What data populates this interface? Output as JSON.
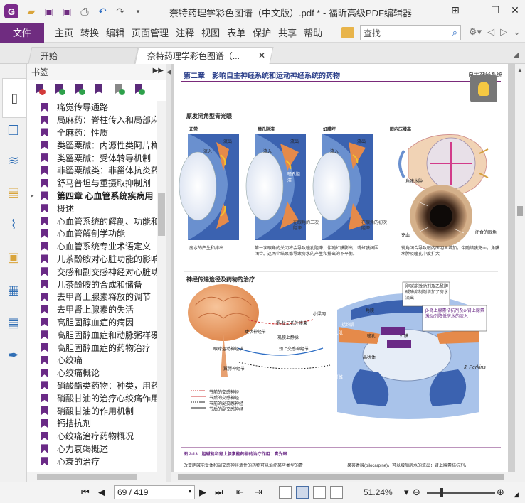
{
  "window": {
    "title": "奈特药理学彩色图谱（中文版）.pdf * - 福昕高级PDF编辑器",
    "app_logo": "G"
  },
  "ribbon": {
    "file_label": "文件",
    "tabs": [
      "主页",
      "转换",
      "编辑",
      "页面管理",
      "注释",
      "视图",
      "表单",
      "保护",
      "共享",
      "帮助"
    ],
    "search_placeholder": "查找"
  },
  "doc_tabs": {
    "start": "开始",
    "current": "奈特药理学彩色图谱（..."
  },
  "bookmarks": {
    "header": "书签",
    "items": [
      {
        "text": "痛觉传导通路",
        "bold": false,
        "expander": false
      },
      {
        "text": "局麻药：脊柱传入和局部麻",
        "bold": false,
        "expander": false
      },
      {
        "text": "全麻药：性质",
        "bold": false,
        "expander": false
      },
      {
        "text": "类罂粟碱：内源性类阿片样",
        "bold": false,
        "expander": false
      },
      {
        "text": "类罂粟碱：受体转导机制",
        "bold": false,
        "expander": false
      },
      {
        "text": "非罂粟碱类：非甾体抗炎药",
        "bold": false,
        "expander": false
      },
      {
        "text": "舒马普坦与重摄取抑制剂",
        "bold": false,
        "expander": false
      },
      {
        "text": "第四章 心血管系统疾病用",
        "bold": true,
        "expander": true
      },
      {
        "text": "概述",
        "bold": false,
        "expander": false
      },
      {
        "text": "心血管系统的解剖、功能和",
        "bold": false,
        "expander": false
      },
      {
        "text": "心血管解剖学功能",
        "bold": false,
        "expander": false
      },
      {
        "text": "心血管系统专业术语定义",
        "bold": false,
        "expander": false
      },
      {
        "text": "儿茶酚胺对心脏功能的影响",
        "bold": false,
        "expander": false
      },
      {
        "text": "交感和副交感神经对心脏功",
        "bold": false,
        "expander": false
      },
      {
        "text": "儿茶酚胺的合成和储备",
        "bold": false,
        "expander": false
      },
      {
        "text": "去甲肾上腺素释放的调节",
        "bold": false,
        "expander": false
      },
      {
        "text": "去甲肾上腺素的失活",
        "bold": false,
        "expander": false
      },
      {
        "text": "高胆固醇血症的病因",
        "bold": false,
        "expander": false
      },
      {
        "text": "高胆固醇血症和动脉粥样硬",
        "bold": false,
        "expander": false
      },
      {
        "text": "高胆固醇血症的药物治疗",
        "bold": false,
        "expander": false
      },
      {
        "text": "心绞痛",
        "bold": false,
        "expander": false
      },
      {
        "text": "心绞痛概论",
        "bold": false,
        "expander": false
      },
      {
        "text": "硝酸酯类药物：种类，用药",
        "bold": false,
        "expander": false
      },
      {
        "text": "硝酸甘油的治疗心绞痛作用",
        "bold": false,
        "expander": false
      },
      {
        "text": "硝酸甘油的作用机制",
        "bold": false,
        "expander": false
      },
      {
        "text": "钙拮抗剂",
        "bold": false,
        "expander": false
      },
      {
        "text": "心绞痛治疗药物概况",
        "bold": false,
        "expander": false
      },
      {
        "text": "心力衰竭概述",
        "bold": false,
        "expander": false
      },
      {
        "text": "心衰的治疗",
        "bold": false,
        "expander": false
      }
    ]
  },
  "page": {
    "chapter_header": "第二章　影响自主神经系统和运动神经系统的药物",
    "header_right": "自主神经系统",
    "section1_title": "原发闭角型青光眼",
    "panel_labels": [
      "正常",
      "瞳孔阻滞",
      "虹膜坪",
      "眼内压增高"
    ],
    "flow_in": "流入",
    "flow_out": "流出",
    "pupil_block_label": "瞳孔阻滞",
    "secondary_block": "在眼角的二次阻滞",
    "primary_block": "在眼角的初次阻滞",
    "angle_edema": "角膜水肿",
    "congested": "充血",
    "closed_angle": "闭合的眼角",
    "caption1": "房水的产生和排出",
    "caption2": "第一次眼角的关闭将会导致瞳孔阻滞，伴随虹膜膨出，或虹膜闭围闭合。这两个结果都导致房水的产生和排出的不平衡。",
    "caption3": "锐角闭合导致眼内压明显增加，伴随结膜充血，角膜水肿及瞳孔中度扩大",
    "section2_title": "神经传递途径及药物的治疗",
    "nerve_labels": [
      "睫状神经节",
      "眼球运动神经核",
      "翼腭神经节",
      "颈上交感神经节",
      "罗-杜二氏外膜束",
      "巩膜上静脉",
      "小梁网",
      "括约肌",
      "开大肌",
      "瞳孔",
      "虹膜",
      "晶状体",
      "角膜",
      "睫状纤维",
      "环状纤维",
      "睫状肌"
    ],
    "drug_box1": "胆碱能激动剂及乙酰胆碱酶抑制剂增加了房水流出",
    "drug_box2": "β-肾上腺素拮抗剂及α-肾上腺素激动剂降低房水的流入",
    "legend": [
      "节前的交感神经",
      "节后的交感神经",
      "节前的副交感神经",
      "节后的副交感神经"
    ],
    "signature": "J. Perkins",
    "figure_caption": "图 2-13　胆碱能和肾上腺素能药物的治疗作用：青光眼",
    "bottom_text_left": "改变胆碱能受体和副交感神经活性的药物可以治疗某些类型的青",
    "bottom_text_right": "果芸香碱(pilocarpine)，可以增加房水的流出；肾上腺素拮抗剂，"
  },
  "status": {
    "page_indicator": "69 / 419",
    "zoom": "51.24%"
  },
  "colors": {
    "accent": "#6f2c80",
    "bookmark_flag": "#6a2a86",
    "chapter_blue": "#2b3f8a"
  }
}
